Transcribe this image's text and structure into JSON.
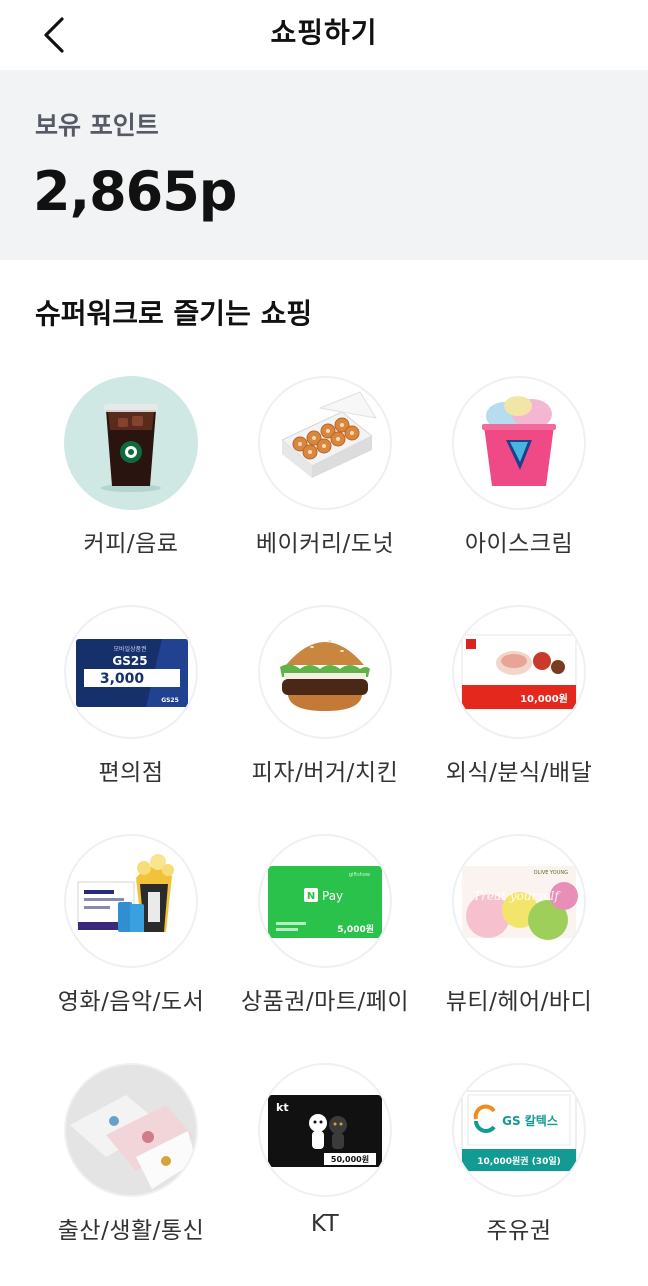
{
  "header": {
    "title": "쇼핑하기"
  },
  "points": {
    "label": "보유 포인트",
    "value": "2,865p"
  },
  "section": {
    "title": "슈퍼워크로 즐기는 쇼핑"
  },
  "categories": [
    {
      "label": "커피/음료",
      "icon": "iced-coffee-image"
    },
    {
      "label": "베이커리/도넛",
      "icon": "donut-box-image"
    },
    {
      "label": "아이스크림",
      "icon": "ice-cream-cup-image"
    },
    {
      "label": "편의점",
      "icon": "gs25-gift-card-image"
    },
    {
      "label": "피자/버거/치킨",
      "icon": "burger-image"
    },
    {
      "label": "외식/분식/배달",
      "icon": "restaurant-voucher-image"
    },
    {
      "label": "영화/음악/도서",
      "icon": "movie-popcorn-image"
    },
    {
      "label": "상품권/마트/페이",
      "icon": "naver-pay-card-image"
    },
    {
      "label": "뷰티/헤어/바디",
      "icon": "olive-young-card-image"
    },
    {
      "label": "출산/생활/통신",
      "icon": "towels-image"
    },
    {
      "label": "KT",
      "icon": "kt-gift-card-image"
    },
    {
      "label": "주유권",
      "icon": "gs-caltex-voucher-image"
    }
  ],
  "cards": {
    "gs25": {
      "line1": "모바일상품권",
      "brand": "GS25",
      "amount": "3,000",
      "footer": "GS25"
    },
    "restaurant": {
      "amount": "10,000원"
    },
    "naverpay": {
      "top": "giftshow",
      "logo": "N",
      "name": "Pay",
      "amount": "5,000원"
    },
    "oliveyoung": {
      "brand": "OLIVE YOUNG",
      "script": "Treat yourself"
    },
    "kt": {
      "logo": "kt",
      "amount": "50,000원"
    },
    "gscaltex": {
      "brand": "GS 칼텍스",
      "amount": "10,000원권 (30일)"
    }
  },
  "colors": {
    "panel_bg": "#f2f3f5",
    "title_text": "#111111",
    "label_text": "#333333",
    "points_label": "#555a66",
    "gs25_blue": "#16306b",
    "naver_green": "#2bc24b",
    "gs_caltex_teal": "#139a93"
  }
}
